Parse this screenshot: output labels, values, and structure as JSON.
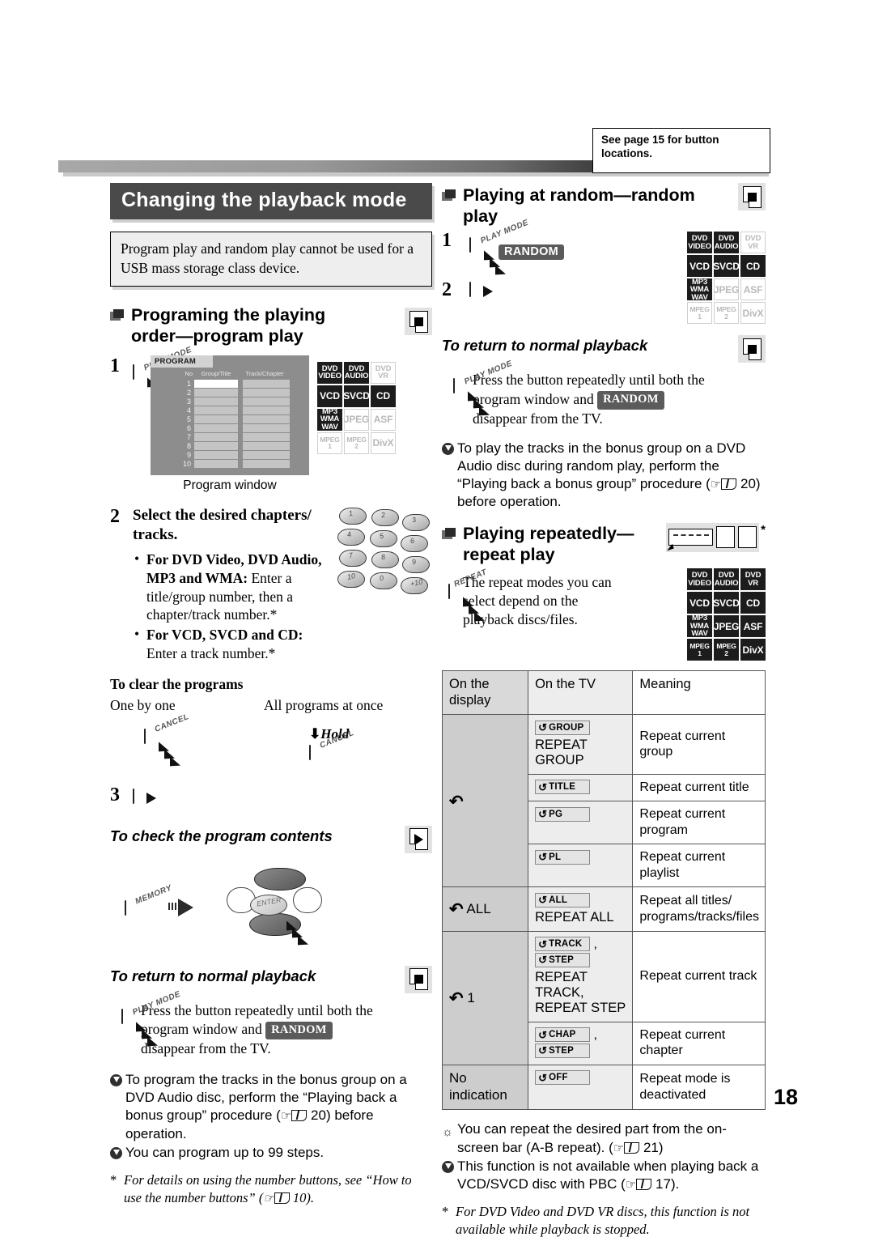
{
  "callout": {
    "line1": "See page 15 for button",
    "line2": "locations."
  },
  "page_number": "18",
  "left": {
    "section_title": "Changing the playback mode",
    "note_box": "Program play and random play cannot be used for a USB mass storage class device.",
    "sub1_title_l1": "Programing the playing",
    "sub1_title_l2": "order—program play",
    "step1_no": "1",
    "btn_play_mode": "PLAY MODE",
    "program_window": {
      "tab": "PROGRAM",
      "col_no": "No",
      "col_group": "Group/Title",
      "col_track": "Track/Chapter",
      "rows": [
        "1",
        "2",
        "3",
        "4",
        "5",
        "6",
        "7",
        "8",
        "9",
        "10"
      ],
      "caption": "Program window"
    },
    "step2_no": "2",
    "step2_title_l1": "Select the desired chapters/",
    "step2_title_l2": "tracks.",
    "bullet1_bold": "For DVD Video, DVD Audio, MP3 and WMA:",
    "bullet1_rest": " Enter a title/group number, then a chapter/track number.*",
    "bullet2_bold": "For VCD, SVCD and CD:",
    "bullet2_rest": " Enter a track number.*",
    "clear_heading": "To clear the programs",
    "clear_one": "One by one",
    "clear_all": "All programs at once",
    "btn_cancel": "CANCEL",
    "hold_label": "Hold",
    "step3_no": "3",
    "check_heading": "To check the program contents",
    "btn_memory": "MEMORY",
    "btn_enter": "ENTER",
    "return_heading": "To return to normal playback",
    "return_text_a": "Press the button repeatedly until both the",
    "return_text_b": "program window and",
    "return_chip": "RANDOM",
    "return_text_c": "disappear from the TV.",
    "note1_a": "To program the tracks in the bonus group on a DVD Audio disc, perform the “Playing back a bonus group” procedure (",
    "note1_page": "20",
    "note1_b": ") before operation.",
    "note2": "You can program up to 99 steps.",
    "footnote_a": "For details on using the number buttons, see “How to use the number buttons” (",
    "footnote_page": "10",
    "footnote_b": ").",
    "badges": [
      {
        "label": "DVD VIDEO",
        "state": "on"
      },
      {
        "label": "DVD AUDIO",
        "state": "on"
      },
      {
        "label": "DVD VR",
        "state": "off"
      },
      {
        "label": "VCD",
        "state": "on"
      },
      {
        "label": "SVCD",
        "state": "on"
      },
      {
        "label": "CD",
        "state": "on"
      },
      {
        "label": "MP3 WMA WAV",
        "state": "on"
      },
      {
        "label": "JPEG",
        "state": "off"
      },
      {
        "label": "ASF",
        "state": "off"
      },
      {
        "label": "MPEG 1",
        "state": "off"
      },
      {
        "label": "MPEG 2",
        "state": "off"
      },
      {
        "label": "DivX",
        "state": "off"
      }
    ]
  },
  "right": {
    "sub2_title_l1": "Playing at random—random",
    "sub2_title_l2": "play",
    "step1_no": "1",
    "step2_no": "2",
    "random_chip": "RANDOM",
    "badges_random": [
      {
        "label": "DVD VIDEO",
        "state": "on"
      },
      {
        "label": "DVD AUDIO",
        "state": "on"
      },
      {
        "label": "DVD VR",
        "state": "off"
      },
      {
        "label": "VCD",
        "state": "on"
      },
      {
        "label": "SVCD",
        "state": "on"
      },
      {
        "label": "CD",
        "state": "on"
      },
      {
        "label": "MP3 WMA WAV",
        "state": "on"
      },
      {
        "label": "JPEG",
        "state": "off"
      },
      {
        "label": "ASF",
        "state": "off"
      },
      {
        "label": "MPEG 1",
        "state": "off"
      },
      {
        "label": "MPEG 2",
        "state": "off"
      },
      {
        "label": "DivX",
        "state": "off"
      }
    ],
    "return_heading": "To return to normal playback",
    "return_text_a": "Press the button repeatedly until both the",
    "return_text_b": "program window and",
    "return_chip": "RANDOM",
    "return_text_c": "disappear from the TV.",
    "note_bonus_a": "To play the tracks in the bonus group on a DVD Audio disc during random play, perform the “Playing back a bonus group” procedure (",
    "note_bonus_page": "20",
    "note_bonus_b": ") before operation.",
    "sub3_title_l1": "Playing repeatedly—",
    "sub3_title_l2": "repeat play",
    "repeat_star": "*",
    "btn_repeat": "REPEAT",
    "repeat_intro_l1": "The repeat modes you can",
    "repeat_intro_l2": "select depend on the",
    "repeat_intro_l3": "playback discs/files.",
    "badges_repeat": [
      {
        "label": "DVD VIDEO",
        "state": "on"
      },
      {
        "label": "DVD AUDIO",
        "state": "on"
      },
      {
        "label": "DVD VR",
        "state": "on"
      },
      {
        "label": "VCD",
        "state": "on"
      },
      {
        "label": "SVCD",
        "state": "on"
      },
      {
        "label": "CD",
        "state": "on"
      },
      {
        "label": "MP3 WMA WAV",
        "state": "on"
      },
      {
        "label": "JPEG",
        "state": "on"
      },
      {
        "label": "ASF",
        "state": "on"
      },
      {
        "label": "MPEG 1",
        "state": "on"
      },
      {
        "label": "MPEG 2",
        "state": "on"
      },
      {
        "label": "DivX",
        "state": "on"
      }
    ],
    "table": {
      "headers": [
        "On the display",
        "On the TV",
        "Meaning"
      ],
      "rows": [
        {
          "display": "",
          "chip1": "GROUP",
          "chip2": "",
          "tvtext": "REPEAT GROUP",
          "meaning": "Repeat current group"
        },
        {
          "display": "",
          "chip1": "TITLE",
          "chip2": "",
          "tvtext": "",
          "meaning": "Repeat current title"
        },
        {
          "display": "",
          "chip1": "PG",
          "chip2": "",
          "tvtext": "",
          "meaning": "Repeat current program"
        },
        {
          "display": "",
          "chip1": "PL",
          "chip2": "",
          "tvtext": "",
          "meaning": "Repeat current playlist"
        },
        {
          "display": "ALL",
          "chip1": "ALL",
          "chip2": "",
          "tvtext": "REPEAT ALL",
          "meaning": "Repeat all titles/ programs/tracks/files"
        },
        {
          "display": "1",
          "chip1": "TRACK",
          "chip2": "STEP",
          "tvtext": "REPEAT TRACK, REPEAT STEP",
          "meaning": "Repeat current track"
        },
        {
          "display": "",
          "chip1": "CHAP",
          "chip2": "STEP",
          "tvtext": "",
          "meaning": "Repeat current chapter"
        },
        {
          "display": "No indication",
          "chip1": "OFF",
          "chip2": "",
          "tvtext": "",
          "meaning": "Repeat mode is deactivated"
        }
      ],
      "display_group1": "",
      "display_group2": "ALL",
      "display_group3": "1",
      "display_group4": "No indication"
    },
    "note_ab_a": "You can repeat the desired part from the on-screen bar (A-B repeat). (",
    "note_ab_page": "21",
    "note_ab_b": ")",
    "note_pbc_a": "This function is not available when playing back a VCD/SVCD disc with PBC (",
    "note_pbc_page": "17",
    "note_pbc_b": ").",
    "footnote": "For DVD Video and DVD VR discs, this function is not available while playback is stopped."
  }
}
